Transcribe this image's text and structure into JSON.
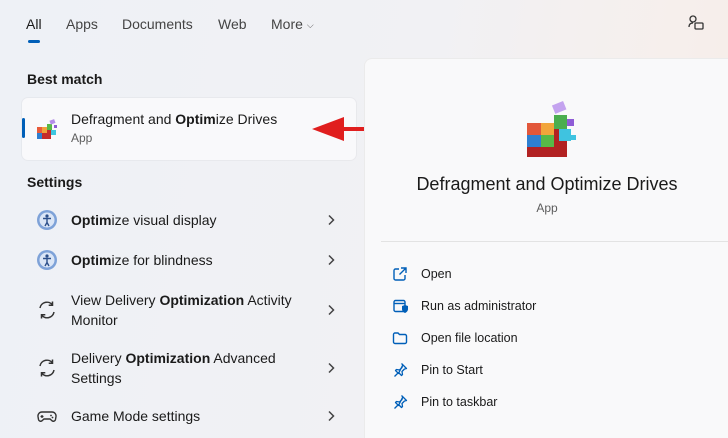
{
  "tabs": {
    "items": [
      {
        "label": "All"
      },
      {
        "label": "Apps"
      },
      {
        "label": "Documents"
      },
      {
        "label": "Web"
      },
      {
        "label": "More"
      }
    ],
    "active": "All"
  },
  "best_match": {
    "heading": "Best match",
    "title_parts": [
      "Defragment and ",
      "Optim",
      "ize Drives"
    ],
    "subtitle": "App"
  },
  "settings": {
    "heading": "Settings",
    "items": [
      {
        "parts": [
          "",
          "Optim",
          "ize visual display"
        ],
        "icon": "accessibility-icon"
      },
      {
        "parts": [
          "",
          "Optim",
          "ize for blindness"
        ],
        "icon": "accessibility-icon"
      },
      {
        "parts": [
          "View Delivery ",
          "Optimization",
          " Activity Monitor"
        ],
        "icon": "sync-icon"
      },
      {
        "parts": [
          "Delivery ",
          "Optimization",
          " Advanced Settings"
        ],
        "icon": "sync-icon"
      },
      {
        "parts": [
          "Game Mode settings",
          "",
          ""
        ],
        "icon": "gamepad-icon"
      }
    ]
  },
  "detail": {
    "title": "Defragment and Optimize Drives",
    "subtitle": "App",
    "actions": [
      {
        "label": "Open",
        "icon": "open-external-icon"
      },
      {
        "label": "Run as administrator",
        "icon": "shield-admin-icon"
      },
      {
        "label": "Open file location",
        "icon": "folder-icon"
      },
      {
        "label": "Pin to Start",
        "icon": "pin-icon"
      },
      {
        "label": "Pin to taskbar",
        "icon": "pin-icon"
      }
    ]
  },
  "colors": {
    "accent": "#005fb8",
    "arrow": "#e01e1e"
  }
}
